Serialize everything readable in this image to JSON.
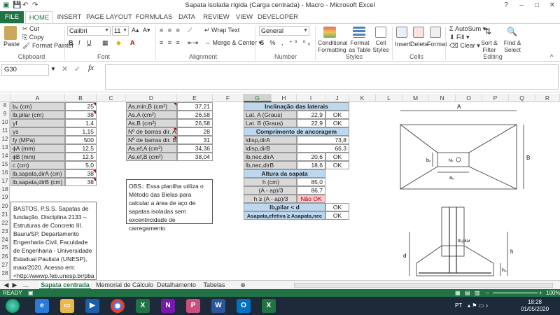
{
  "window": {
    "title": "Sapata isolada rígida (Carga centrada) - Macro - Microsoft Excel"
  },
  "ribbon_tabs": [
    "FILE",
    "HOME",
    "INSERT",
    "PAGE LAYOUT",
    "FORMULAS",
    "DATA",
    "REVIEW",
    "VIEW",
    "DEVELOPER"
  ],
  "ribbon": {
    "clipboard": {
      "paste": "Paste",
      "cut": "Cut",
      "copy": "Copy",
      "format_painter": "Format Painter",
      "group": "Clipboard"
    },
    "font": {
      "name": "Calibri",
      "size": "11",
      "group": "Font"
    },
    "alignment": {
      "wrap": "Wrap Text",
      "merge": "Merge & Center",
      "group": "Alignment"
    },
    "number": {
      "format": "General",
      "group": "Number"
    },
    "styles": {
      "cond": "Conditional Formatting",
      "table": "Format as Table",
      "cell": "Cell Styles",
      "group": "Styles"
    },
    "cells": {
      "insert": "Insert",
      "delete": "Delete",
      "format": "Format",
      "group": "Cells"
    },
    "editing": {
      "autosum": "AutoSum",
      "fill": "Fill",
      "clear": "Clear",
      "sort": "Sort & Filter",
      "find": "Find & Select",
      "group": "Editing"
    }
  },
  "namebox": "G30",
  "fx": "fx",
  "columns": [
    "A",
    "B",
    "C",
    "D",
    "E",
    "F",
    "G",
    "H",
    "I",
    "J",
    "K",
    "L",
    "M",
    "N",
    "O",
    "P",
    "Q",
    "R"
  ],
  "rows": [
    "8",
    "9",
    "10",
    "11",
    "12",
    "13",
    "14",
    "15",
    "16",
    "17",
    "18",
    "19",
    "20",
    "21",
    "22",
    "23",
    "24",
    "25",
    "26",
    "27",
    "28",
    "29",
    "30",
    "31"
  ],
  "left_table": [
    {
      "label": "b₀ (cm)",
      "value": "25"
    },
    {
      "label": "lb,pilar (cm)",
      "value": "38"
    },
    {
      "label": "γf",
      "value": "1,4"
    },
    {
      "label": "γs",
      "value": "1,15"
    },
    {
      "label": "fy (MPa)",
      "value": "500"
    },
    {
      "label": "ϕA (mm)",
      "value": "12,5"
    },
    {
      "label": "ϕB (mm)",
      "value": "12,5"
    },
    {
      "label": "c (cm)",
      "value": "5,0"
    },
    {
      "label": "lb,sapata,dirA (cm)",
      "value": "38"
    },
    {
      "label": "lb,sapata,dirB (cm)",
      "value": "38"
    }
  ],
  "mid_table": [
    {
      "label": "As,min,B (cm²)",
      "value": "37,21"
    },
    {
      "label": "As,A (cm²)",
      "value": "26,58"
    },
    {
      "label": "As,B (cm²)",
      "value": "26,58"
    },
    {
      "label": "Nº de barras dir. A",
      "value": "28"
    },
    {
      "label": "Nº de barras dir. B",
      "value": "31"
    },
    {
      "label": "As,ef,A (cm²)",
      "value": "34,36"
    },
    {
      "label": "As,ef,B (cm²)",
      "value": "38,04"
    }
  ],
  "right_tables": {
    "inclinacao": {
      "title": "Inclinação das laterais",
      "rows": [
        {
          "label": "Lat. A (Graus)",
          "value": "22,9",
          "status": "OK"
        },
        {
          "label": "Lat. B (Graus)",
          "value": "22,9",
          "status": "OK"
        }
      ]
    },
    "ancoragem": {
      "title": "Comprimento de ancoragem",
      "rows": [
        {
          "label": "ldisp,dirA",
          "value": "73,8",
          "status": ""
        },
        {
          "label": "ldisp,dirB",
          "value": "66,3",
          "status": ""
        },
        {
          "label": "lb,nec,dirA",
          "value": "20,6",
          "status": "OK"
        },
        {
          "label": "lb,nec,dirB",
          "value": "18,6",
          "status": "OK"
        }
      ]
    },
    "altura": {
      "title": "Altura da sapata",
      "rows": [
        {
          "label": "h (cm)",
          "value": "85,0",
          "status": ""
        },
        {
          "label": "(A - ap)/3",
          "value": "86,7",
          "status": ""
        },
        {
          "label": "h ≥ (A - ap)/3",
          "value": "Não OK",
          "status": ""
        }
      ]
    },
    "checks": [
      {
        "label": "lb,pilar < d",
        "status": "OK"
      },
      {
        "label": "Asapata,efetiva ≥ Asapata,nec",
        "status": "OK"
      }
    ]
  },
  "note": "OBS.: Essa planilha utiliza o Método das Bielas para calcular a área de aço de sapatas isoladas sem excentricidade de carregamento",
  "reference": "BASTOS, P.S.S. Sapatas de fundação. Disciplina 2133 – Estruturas de Concreto III. Bauru/SP, Departamento Engenharia Civil, Faculdade de Engenharia - Universidade Estadual Paulista (UNESP), maio/2020. Acesso em: <http://wwwp.feb.unesp.br/pba",
  "drawing": {
    "A": "A",
    "B": "B",
    "b0": "b₀",
    "a0": "a₀",
    "Nk": "Nₖ",
    "d": "d",
    "h": "h",
    "h0": "h₀",
    "lbpilar": "lb,pilar"
  },
  "sheet_tabs": [
    "Sapata centrada",
    "Memorial de Cálculo",
    "Detalhamento",
    "Tabelas"
  ],
  "status": {
    "ready": "READY",
    "zoom": "100%"
  },
  "taskbar": {
    "lang": "PT",
    "time": "18:28",
    "date": "01/05/2020"
  }
}
